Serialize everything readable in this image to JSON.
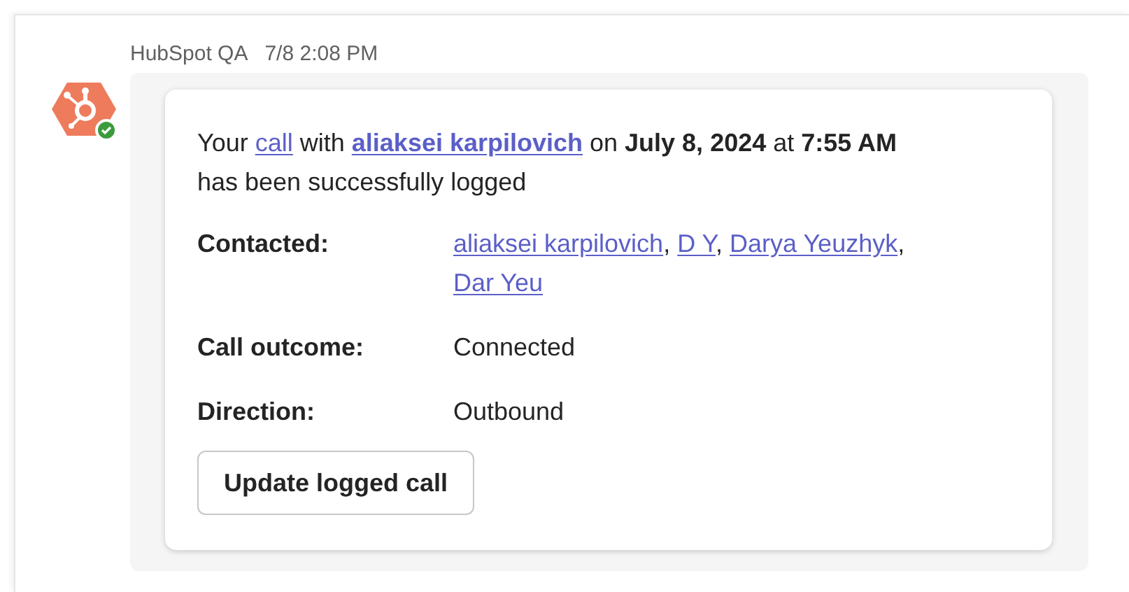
{
  "message": {
    "sender": "HubSpot QA",
    "time": "7/8 2:08 PM",
    "sentence": [
      {
        "kind": "text",
        "text": "Your "
      },
      {
        "kind": "link",
        "text": "call"
      },
      {
        "kind": "text",
        "text": " with "
      },
      {
        "kind": "bold-link",
        "text": "aliaksei karpilovich"
      },
      {
        "kind": "text",
        "text": " on "
      },
      {
        "kind": "bold",
        "text": "July 8, 2024"
      },
      {
        "kind": "text",
        "text": " at "
      },
      {
        "kind": "bold",
        "text": "7:55 AM"
      },
      {
        "kind": "text",
        "text": " has been successfully logged"
      }
    ],
    "fields": [
      {
        "label": "Contacted:",
        "kind": "links",
        "separator": ",",
        "links": [
          "aliaksei karpilovich",
          "D Y",
          "Darya Yeuzhyk",
          "Dar Yeu"
        ]
      },
      {
        "label": "Call outcome:",
        "kind": "text",
        "value": "Connected"
      },
      {
        "label": "Direction:",
        "kind": "text",
        "value": "Outbound"
      }
    ],
    "button": "Update logged call"
  }
}
